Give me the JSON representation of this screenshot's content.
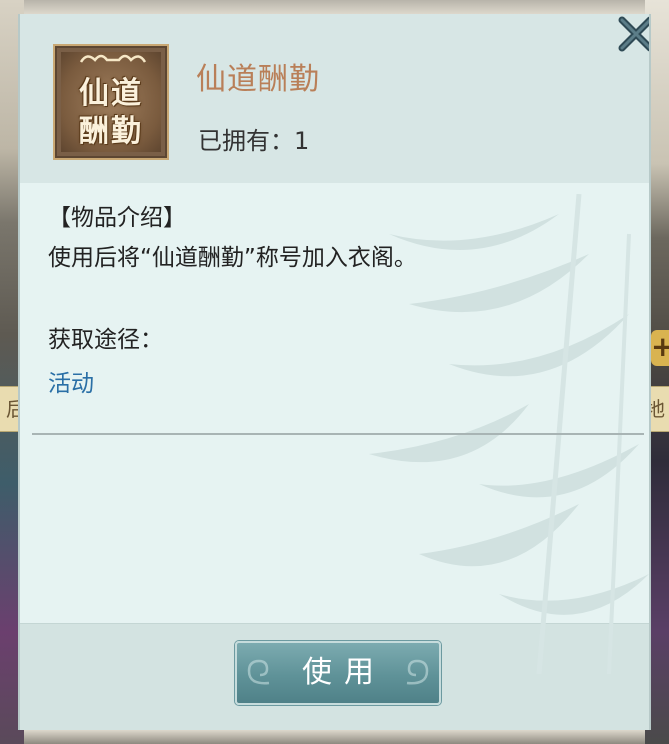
{
  "dialog": {
    "item_name": "仙道酬勤",
    "owned_label": "已拥有：",
    "owned_count": "1",
    "icon": {
      "line1": "仙道",
      "line2": "酬勤"
    },
    "close_icon": "close-x-icon"
  },
  "description": {
    "header": "【物品介绍】",
    "text": "使用后将“仙道酬勤”称号加入衣阁。",
    "source_header": "获取途径：",
    "source_link": "活动"
  },
  "actions": {
    "use_label": "使用"
  },
  "background": {
    "left_chip": "后",
    "right_chip": "地",
    "right_plus": "+"
  },
  "colors": {
    "item_name": "#b97f58",
    "link": "#2a6fa6",
    "button": "#5f9298"
  }
}
